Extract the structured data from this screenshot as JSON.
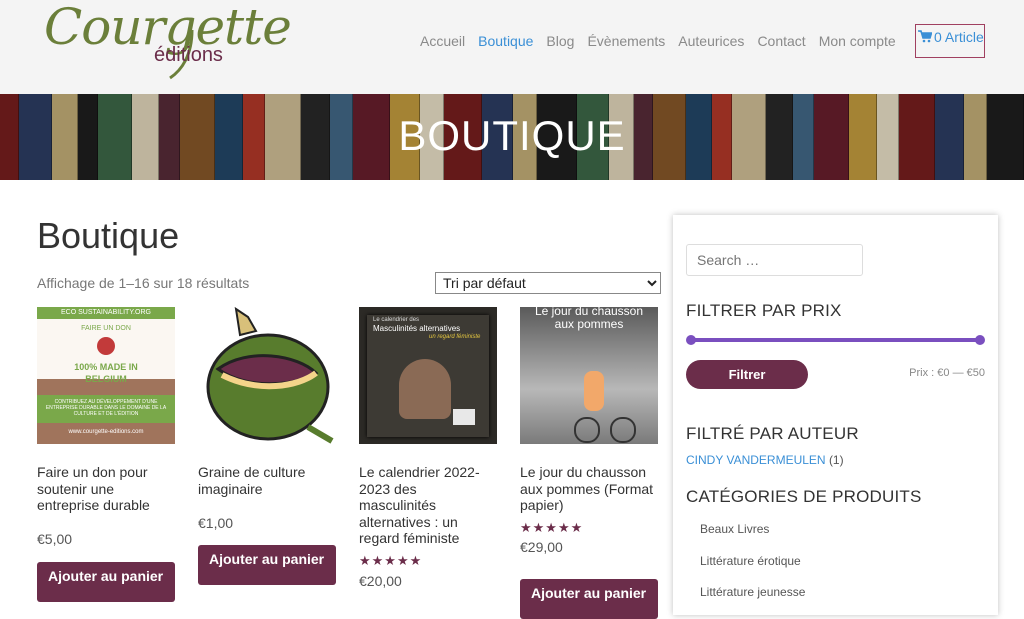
{
  "logo": {
    "text": "Courgette",
    "subtext": "éditions"
  },
  "nav": {
    "items": [
      "Accueil",
      "Boutique",
      "Blog",
      "Évènements",
      "Auteurices",
      "Contact",
      "Mon compte"
    ],
    "active_index": 1,
    "cart_label": "0 Article",
    "cart_icon": "shopping-cart-icon"
  },
  "banner": {
    "title": "BOUTIQUE"
  },
  "main": {
    "title": "Boutique",
    "result_count": "Affichage de 1–16 sur 18 résultats",
    "sort_selected": "Tri par défaut"
  },
  "products": [
    {
      "name": "Faire un don pour soutenir une entreprise durable",
      "price": "€5,00",
      "button": "Ajouter au panier",
      "rating": null,
      "image_text": {
        "org": "ECO SUSTAINABILITY.ORG",
        "don": "FAIRE UN DON",
        "made": "100% MADE IN BELGIUM",
        "desc": "CONTRIBUEZ AU DÉVELOPPEMENT D'UNE ENTREPRISE DURABLE DANS LE DOMAINE DE LA CULTURE ET DE L'ÉDITION",
        "url": "www.courgette-editions.com"
      }
    },
    {
      "name": "Graine de culture imaginaire",
      "price": "€1,00",
      "button": "Ajouter au panier",
      "rating": null
    },
    {
      "name": "Le calendrier 2022-2023 des masculinités alternatives : un regard féministe",
      "price": "€20,00",
      "button": "",
      "rating": "★★★★★",
      "image_text": {
        "top": "Le calendrier des",
        "title": "Masculinités alternatives",
        "sub": "un regard féministe"
      }
    },
    {
      "name": "Le jour du chausson aux pommes (Format papier)",
      "price": "€29,00",
      "button": "Ajouter au panier",
      "rating": "★★★★★",
      "image_text": {
        "title": "Le jour du chausson aux pommes"
      }
    }
  ],
  "sidebar": {
    "search_placeholder": "Search …",
    "price_filter_title": "FILTRER PAR PRIX",
    "filter_button": "Filtrer",
    "price_range": "Prix : €0 — €50",
    "price_min": 0,
    "price_max": 50,
    "author_title": "FILTRÉ PAR AUTEUR",
    "author_name": "CINDY VANDERMEULEN",
    "author_count": "(1)",
    "categories_title": "CATÉGORIES DE PRODUITS",
    "categories": [
      "Beaux Livres",
      "Littérature érotique",
      "Littérature jeunesse"
    ]
  },
  "colors": {
    "brand": "#6b2d4a",
    "accent": "#3a8fd6",
    "slider": "#7a4fbf",
    "logo_green": "#6b7f3a"
  }
}
